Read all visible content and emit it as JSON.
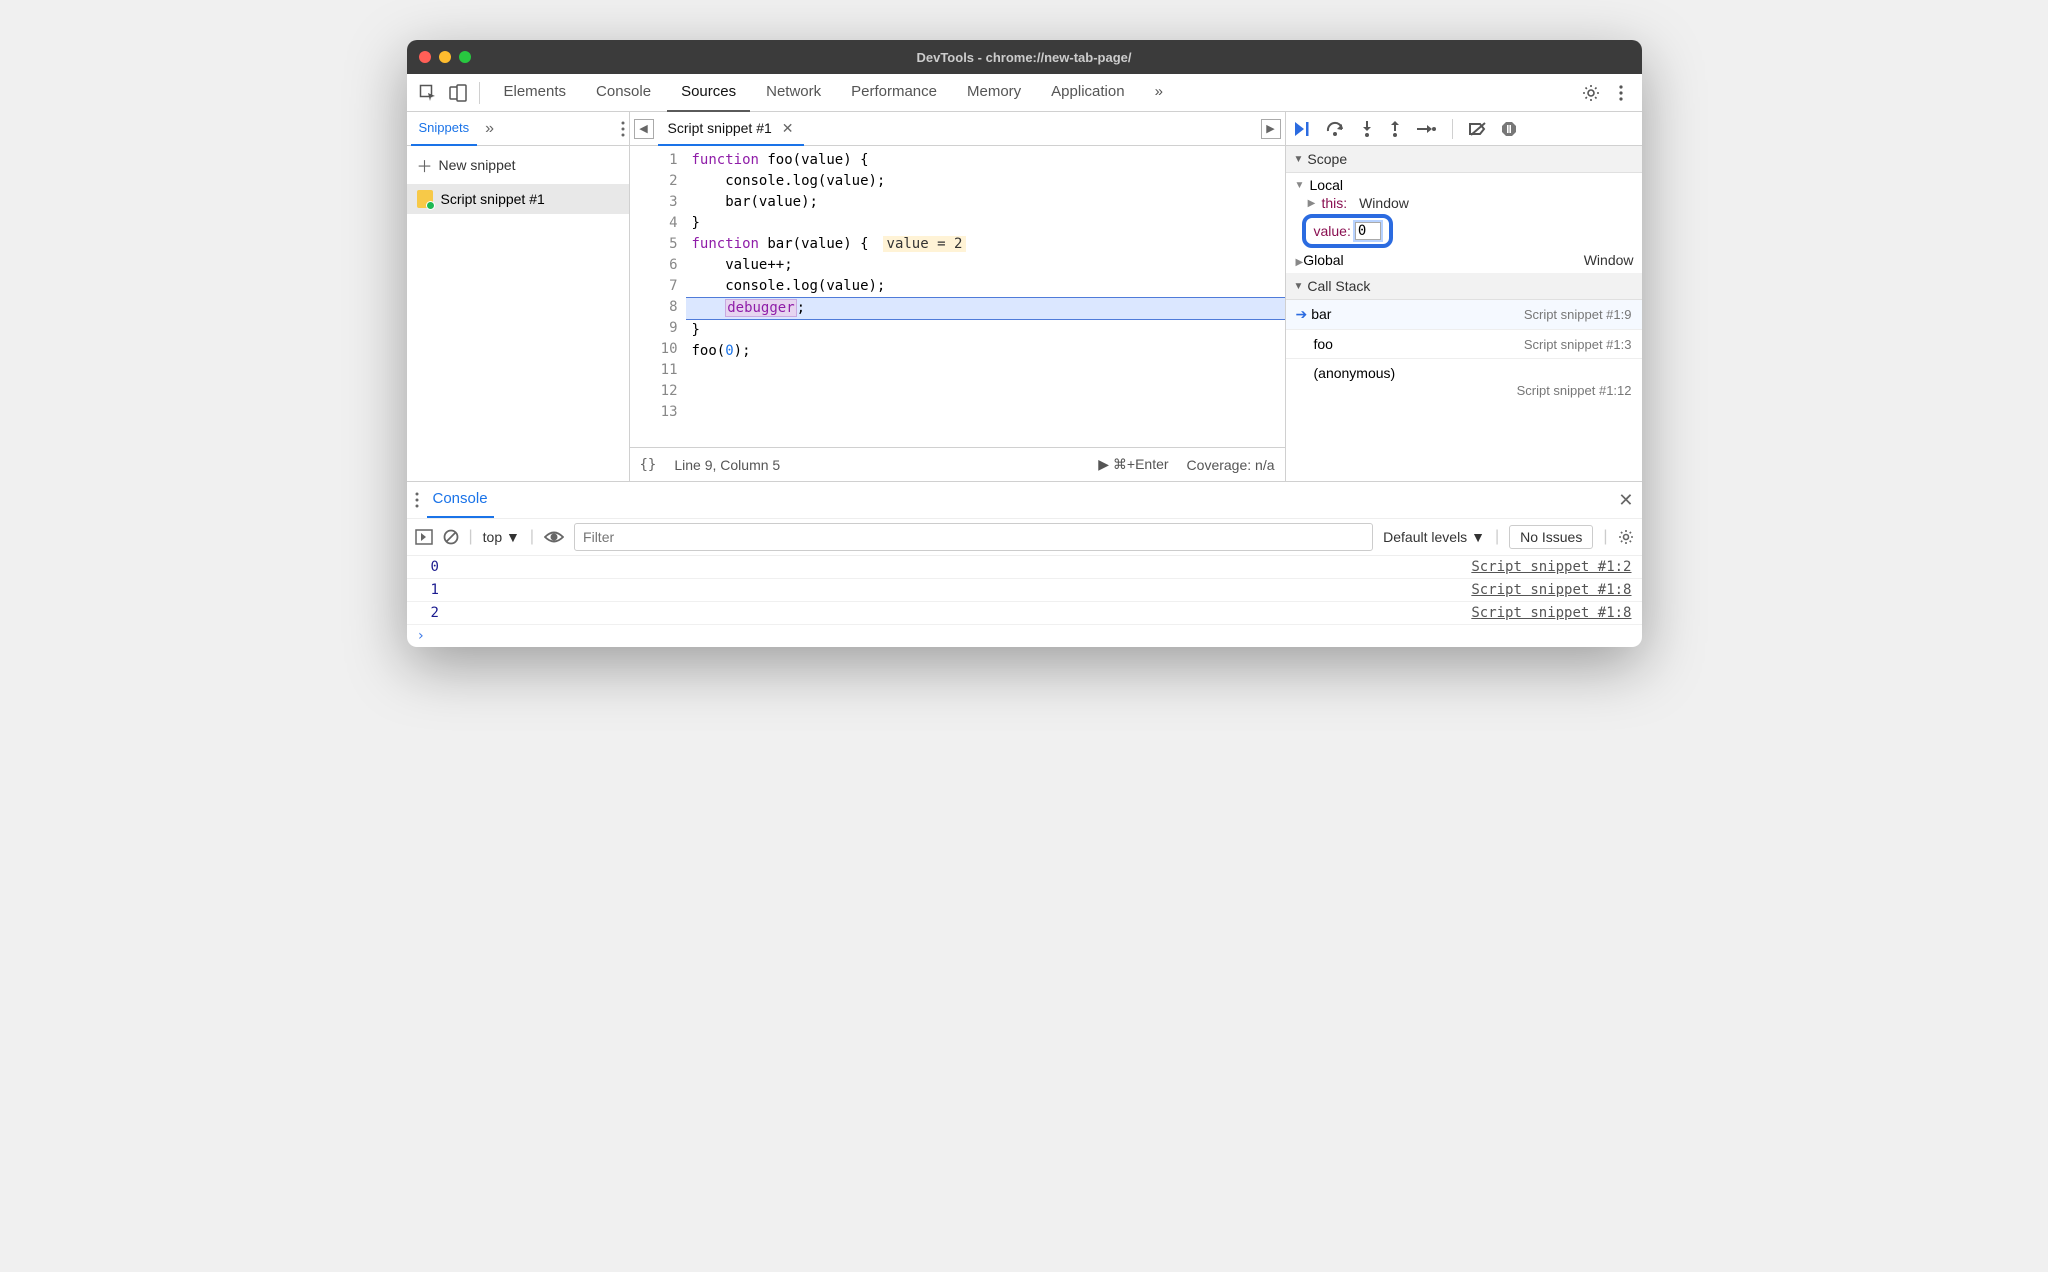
{
  "window_title": "DevTools - chrome://new-tab-page/",
  "top_tabs": {
    "elements": "Elements",
    "console": "Console",
    "sources": "Sources",
    "network": "Network",
    "performance": "Performance",
    "memory": "Memory",
    "application": "Application"
  },
  "leftnav": {
    "tab": "Snippets",
    "new_label": "New snippet",
    "item": "Script snippet #1"
  },
  "editor": {
    "tab": "Script snippet #1",
    "lines": {
      "l1a": "function",
      "l1b": " foo(value) {",
      "l2": "    console.log(value);",
      "l3": "    bar(value);",
      "l4": "}",
      "l5": "",
      "l6a": "function",
      "l6b": " bar(value) {",
      "l6hint": "value = 2",
      "l7": "    value++;",
      "l8": "    console.log(value);",
      "l9a": "    ",
      "l9b": "debugger",
      "l9c": ";",
      "l10": "}",
      "l11": "",
      "l12a": "foo(",
      "l12b": "0",
      "l12c": ");",
      "l13": ""
    },
    "gutter": [
      "1",
      "2",
      "3",
      "4",
      "5",
      "6",
      "7",
      "8",
      "9",
      "10",
      "11",
      "12",
      "13"
    ],
    "status_cursor": "Line 9, Column 5",
    "status_run": "⌘+Enter",
    "status_coverage": "Coverage: n/a",
    "curly": "{}"
  },
  "debug": {
    "scope_head": "Scope",
    "local": "Local",
    "this_k": "this",
    "this_v": "Window",
    "value_k": "value",
    "value_v": "0",
    "global_k": "Global",
    "global_v": "Window",
    "callstack_head": "Call Stack",
    "stack": [
      {
        "name": "bar",
        "loc": "Script snippet #1:9"
      },
      {
        "name": "foo",
        "loc": "Script snippet #1:3"
      }
    ],
    "anon": "(anonymous)",
    "anon_loc": "Script snippet #1:12"
  },
  "drawer": {
    "tab": "Console",
    "context": "top",
    "filter_placeholder": "Filter",
    "levels": "Default levels",
    "noissues": "No Issues",
    "logs": [
      {
        "val": "0",
        "loc": "Script snippet #1:2"
      },
      {
        "val": "1",
        "loc": "Script snippet #1:8"
      },
      {
        "val": "2",
        "loc": "Script snippet #1:8"
      }
    ]
  }
}
